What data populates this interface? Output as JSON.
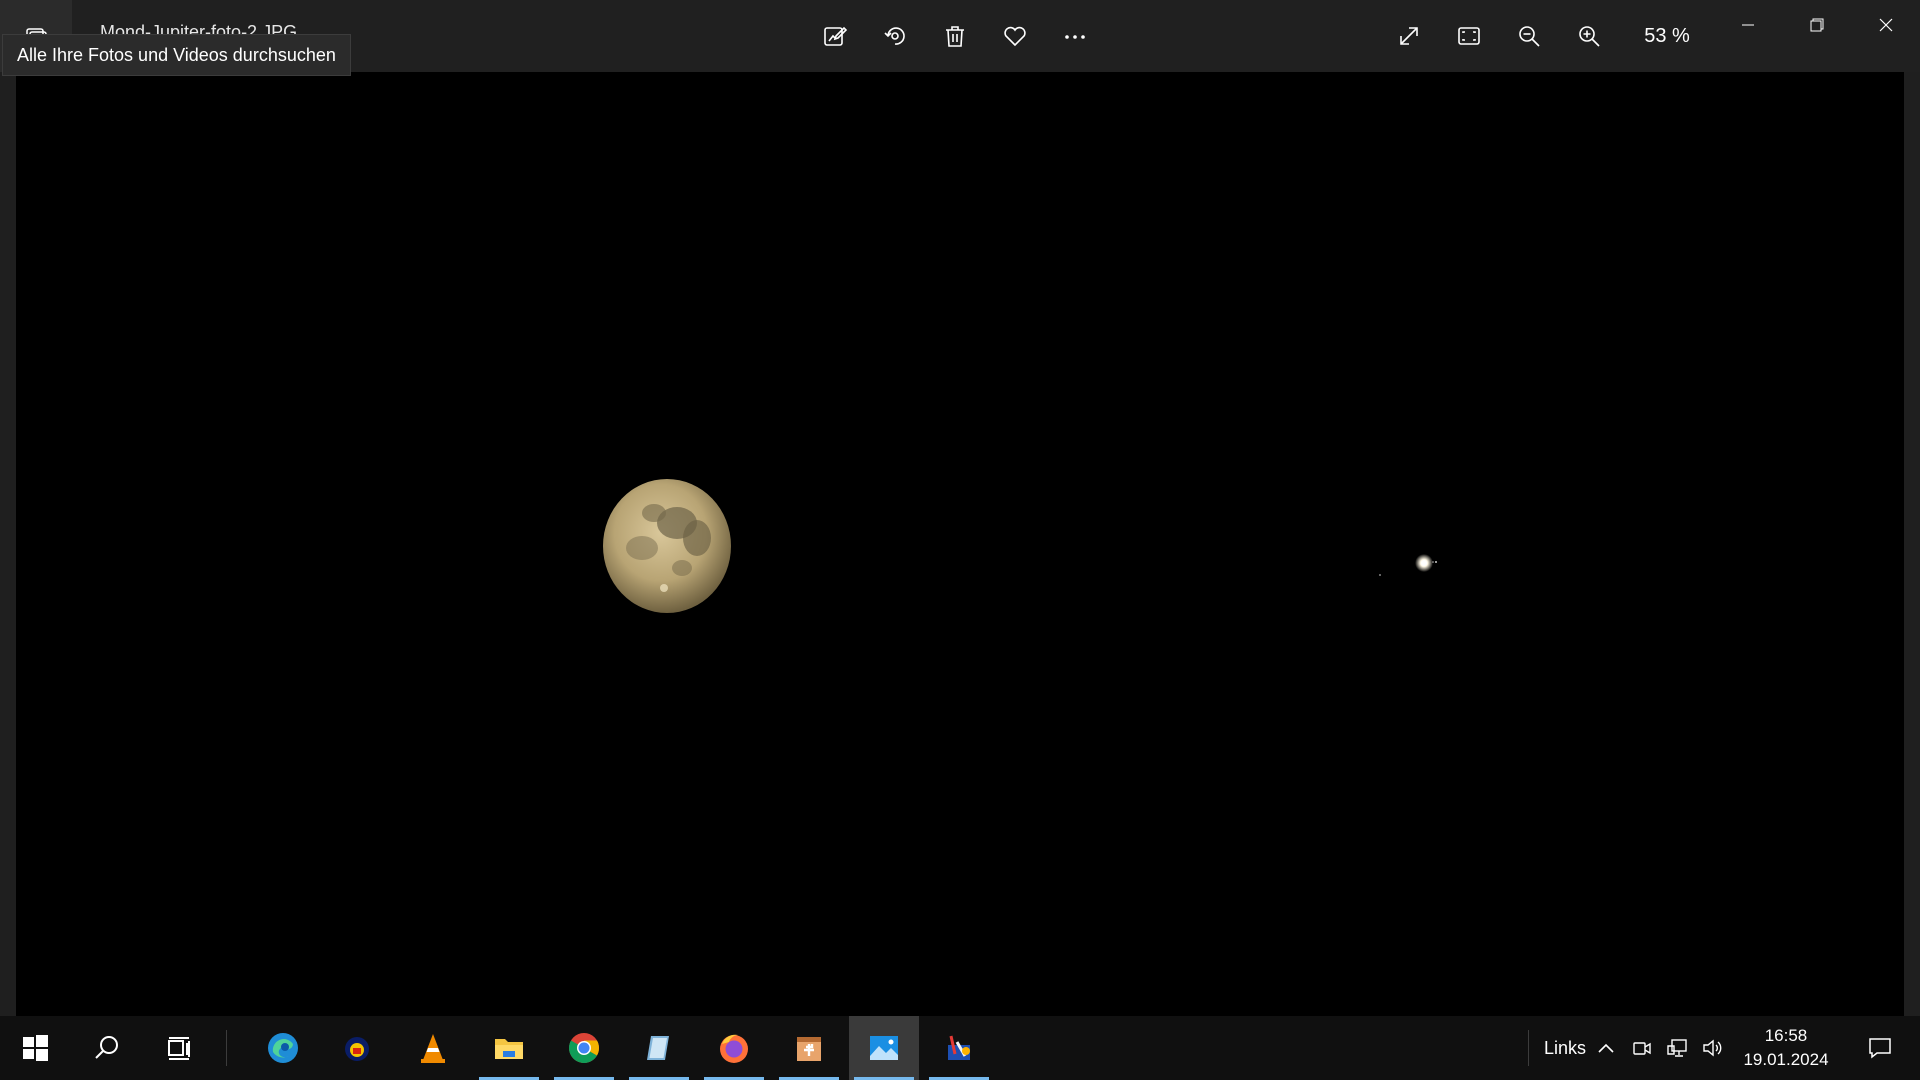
{
  "titlebar": {
    "filename": "Mond-Jupiter-foto-2.JPG",
    "tooltip": "Alle Ihre Fotos und Videos durchsuchen",
    "back_icon": "photos-app-icon"
  },
  "toolbar": {
    "buttons": [
      {
        "name": "edit-create-button",
        "icon": "edit-image-icon"
      },
      {
        "name": "rotate-button",
        "icon": "rotate-icon"
      },
      {
        "name": "delete-button",
        "icon": "trash-icon"
      },
      {
        "name": "favorite-button",
        "icon": "heart-icon"
      },
      {
        "name": "more-button",
        "icon": "more-dots-icon"
      }
    ],
    "view_buttons": [
      {
        "name": "fullscreen-button",
        "icon": "expand-icon"
      },
      {
        "name": "fit-window-button",
        "icon": "fit-icon"
      },
      {
        "name": "zoom-out-button",
        "icon": "zoom-out-icon"
      },
      {
        "name": "zoom-in-button",
        "icon": "zoom-in-icon"
      }
    ],
    "zoom_level": "53 %"
  },
  "window_controls": [
    "minimize",
    "restore",
    "close"
  ],
  "image": {
    "subjects": [
      "moon",
      "jupiter"
    ]
  },
  "taskbar": {
    "apps": [
      {
        "name": "edge",
        "icon": "edge-icon"
      },
      {
        "name": "app-yellow",
        "icon": "app-icon"
      },
      {
        "name": "vlc",
        "icon": "vlc-icon"
      },
      {
        "name": "explorer",
        "icon": "folder-icon"
      },
      {
        "name": "chrome",
        "icon": "chrome-icon"
      },
      {
        "name": "app-blue",
        "icon": "notepad-icon"
      },
      {
        "name": "firefox",
        "icon": "firefox-icon"
      },
      {
        "name": "app-box",
        "icon": "box-icon"
      },
      {
        "name": "photos",
        "icon": "photos-icon"
      },
      {
        "name": "app-tools",
        "icon": "tools-icon"
      }
    ],
    "tray_label": "Links",
    "time": "16:58",
    "date": "19.01.2024"
  },
  "colors": {
    "accent": "#76b9ed",
    "titlebar": "#202020",
    "taskbar": "#101010"
  }
}
